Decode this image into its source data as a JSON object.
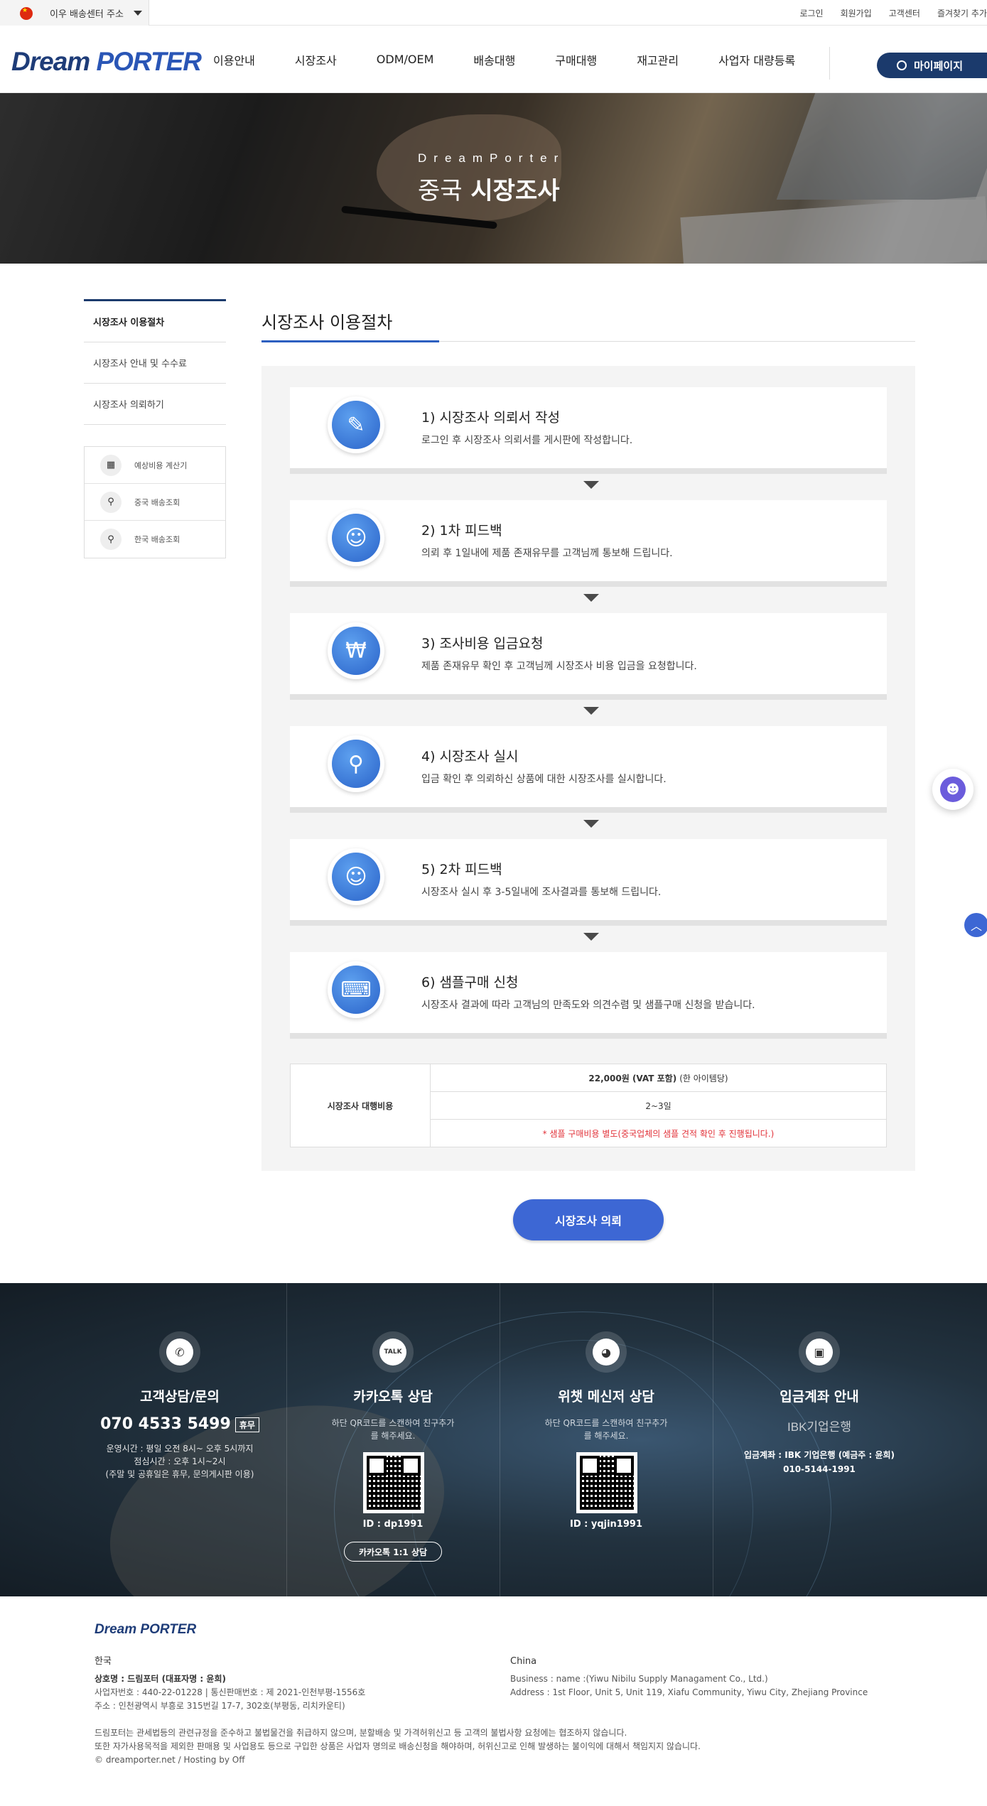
{
  "topbar": {
    "address_label": "이우 배송센터 주소",
    "links": [
      "로그인",
      "회원가입",
      "고객센터",
      "즐겨찾기 추가"
    ]
  },
  "header": {
    "logo_part1": "Dream",
    "logo_part2": "PORTER",
    "nav": [
      "이용안내",
      "시장조사",
      "ODM/OEM",
      "배송대행",
      "구매대행",
      "재고관리",
      "사업자 대량등록"
    ],
    "mypage_label": "마이페이지"
  },
  "hero": {
    "subtitle": "DreamPorter",
    "title_light": "중국",
    "title_bold": "시장조사"
  },
  "sidebar": {
    "items": [
      "시장조사 이용절차",
      "시장조사 안내 및 수수료",
      "시장조사 의뢰하기"
    ],
    "tools": [
      {
        "icon": "calculator-icon",
        "label": "예상비용 계산기"
      },
      {
        "icon": "search-icon",
        "label": "중국 배송조회"
      },
      {
        "icon": "search-icon",
        "label": "한국 배송조회"
      }
    ]
  },
  "main": {
    "title": "시장조사 이용절차",
    "steps": [
      {
        "icon": "document-icon",
        "title": "1) 시장조사 의뢰서 작성",
        "desc": "로그인 후 시장조사 의뢰서를 게시판에 작성합니다."
      },
      {
        "icon": "agent-icon",
        "title": "2) 1차 피드백",
        "desc": "의뢰 후 1일내에 제품 존재유무를 고객님께 통보해 드립니다."
      },
      {
        "icon": "payment-icon",
        "title": "3) 조사비용 입금요청",
        "desc": "제품 존재유무 확인 후 고객님께 시장조사 비용 입금을 요청합니다."
      },
      {
        "icon": "magnifier-globe-icon",
        "title": "4) 시장조사 실시",
        "desc": "입금 확인 후 의뢰하신 상품에 대한 시장조사를 실시합니다."
      },
      {
        "icon": "agent-icon",
        "title": "5) 2차 피드백",
        "desc": "시장조사 실시 후 3-5일내에 조사결과를 통보해 드립니다."
      },
      {
        "icon": "shopping-basket-icon",
        "title": "6) 샘플구매 신청",
        "desc": "시장조사 결과에 따라 고객님의 만족도와 의견수렴 및 샘플구매 신청을 받습니다."
      }
    ],
    "fee": {
      "label": "시장조사 대행비용",
      "price": "22,000원 (VAT 포함)",
      "price_unit": "(한 아이템당)",
      "duration": "2~3일",
      "note": "* 샘플 구매비용 별도(중국업체의 샘플 견적 확인 후 진행됩니다.)"
    },
    "request_button": "시장조사 의뢰"
  },
  "contact": {
    "phone": {
      "title": "고객상담/문의",
      "number": "070 4533 5499",
      "badge": "휴무",
      "hours": "운영시간 : 평일 오전 8시~ 오후 5시까지",
      "lunch": "점심시간 : 오후 1시~2시",
      "holiday": "(주말 및 공휴일은 휴무, 문의게시판 이용)"
    },
    "kakao": {
      "title": "카카오톡 상담",
      "note": "하단 QR코드를 스캔하여 친구추가를 해주세요.",
      "id": "ID : dp1991",
      "button": "카카오톡 1:1 상담"
    },
    "wechat": {
      "title": "위챗 메신저 상담",
      "note": "하단 QR코드를 스캔하여 친구추가를 해주세요.",
      "id": "ID : yqjin1991"
    },
    "bank": {
      "title": "입금계좌 안내",
      "bank_logo": "IBK기업은행",
      "account_line1": "입금계좌 : IBK 기업은행 (예금주 : 윤희)",
      "account_line2": "010-5144-1991"
    }
  },
  "footer": {
    "logo": "Dream PORTER",
    "korea": {
      "head": "한국",
      "company": "상호명 : 드림포터 (대표자명 : 윤희)",
      "reg": "사업자번호 : 440-22-01228 | 통신판매번호 : 제 2021-인천부평-1556호",
      "address": "주소 : 인천광역시 부흥로 315번길 17-7, 302호(부평동, 리치카운티)"
    },
    "china": {
      "head": "China",
      "business": "Business : name :(Yiwu Nibilu Supply Managament Co., Ltd.)",
      "address": "Address : 1st Floor, Unit 5, Unit 119, Xiafu Community, Yiwu City, Zhejiang Province"
    },
    "notice1": "드림포터는 관세법등의 관련규정을 준수하고 불법물건을 취급하지 않으며, 분할배송 및 가격허위신고 등 고객의 불법사항 요청에는 협조하지 않습니다.",
    "notice2": "또한 자가사용목적을 제외한 판매용 및 사업용도 등으로 구입한 상품은 사업자 명의로 배송신청을 해야하며, 허위신고로 인해 발생하는 불이익에 대해서 책임지지 않습니다.",
    "copyright": "© dreamporter.net / Hosting by Off"
  },
  "colors": {
    "brand_navy": "#1b3a6c",
    "accent_blue": "#3d67d4",
    "note_red": "#e2333a"
  }
}
